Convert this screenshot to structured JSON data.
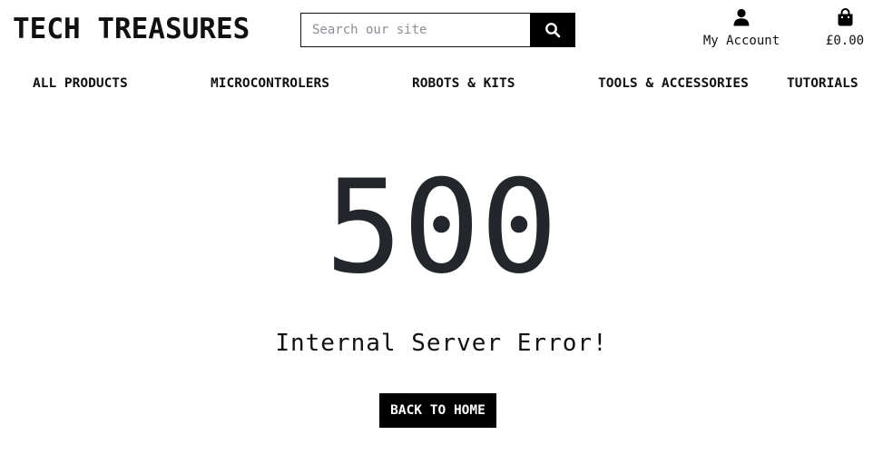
{
  "header": {
    "brand": "TECH TREASURES",
    "search": {
      "placeholder": "Search our site",
      "value": "",
      "button_icon": "search-icon"
    },
    "account": {
      "icon": "user-icon",
      "label": "My Account"
    },
    "cart": {
      "icon": "shopping-bag-icon",
      "total": "£0.00"
    }
  },
  "nav": {
    "items": [
      {
        "label": "ALL PRODUCTS"
      },
      {
        "label": "MICROCONTROLERS"
      },
      {
        "label": "ROBOTS & KITS"
      },
      {
        "label": "TOOLS & ACCESSORIES"
      },
      {
        "label": "TUTORIALS"
      }
    ]
  },
  "main": {
    "error_code": "500",
    "error_message": "Internal Server Error!",
    "home_button": "BACK TO HOME"
  },
  "colors": {
    "text": "#111111",
    "error_code": "#23262b",
    "button_bg": "#000000",
    "button_text": "#ffffff",
    "placeholder": "#8a8f96"
  }
}
